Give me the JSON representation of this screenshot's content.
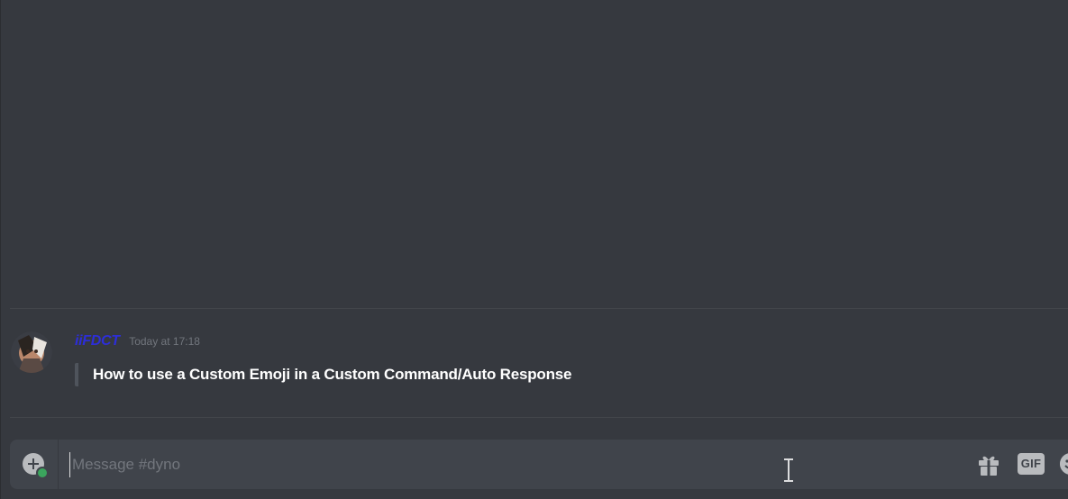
{
  "message": {
    "username": "iiFDCT",
    "timestamp": "Today at 17:18",
    "embed_title": "How to use a Custom Emoji in a Custom Command/Auto Response"
  },
  "composer": {
    "placeholder": "Message #dyno",
    "value": "",
    "gif_label": "GIF",
    "icons": {
      "attach": "plus-circle-icon",
      "gift": "gift-icon",
      "emoji": "emoji-icon"
    }
  },
  "colors": {
    "background": "#36393f",
    "composer_bg": "#40444b",
    "username": "#2d2ed8",
    "embed_border": "#4f545c"
  }
}
